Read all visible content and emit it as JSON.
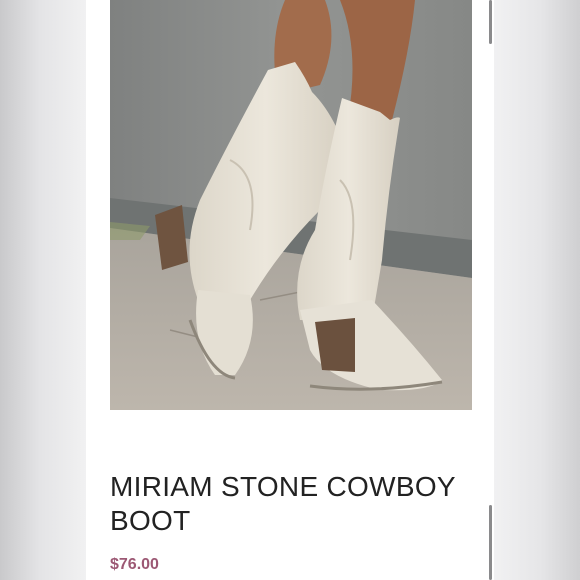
{
  "product": {
    "image_alt": "White stone cowboy boots",
    "title": "MIRIAM STONE COWBOY BOOT",
    "price": "$76.00"
  },
  "colors": {
    "price": "#9c5874",
    "title": "#222222",
    "card_bg": "#ffffff"
  }
}
